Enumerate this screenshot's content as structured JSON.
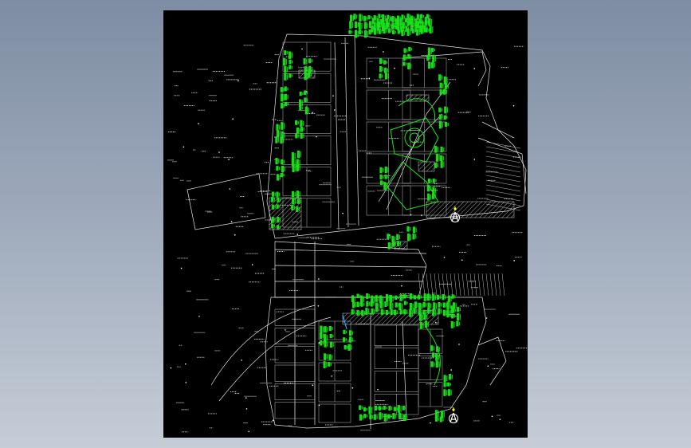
{
  "viewer": {
    "canvas_background": "gradient-steel-blue",
    "sheet_background": "#000000",
    "linework_color": "#e6e6e6",
    "annotation_color": "#19e619",
    "marker_color": "#ffff00"
  },
  "drawing": {
    "north_arrow_top": {
      "icon": "north-arrow-icon"
    },
    "north_arrow_bottom": {
      "icon": "north-arrow-icon"
    }
  }
}
